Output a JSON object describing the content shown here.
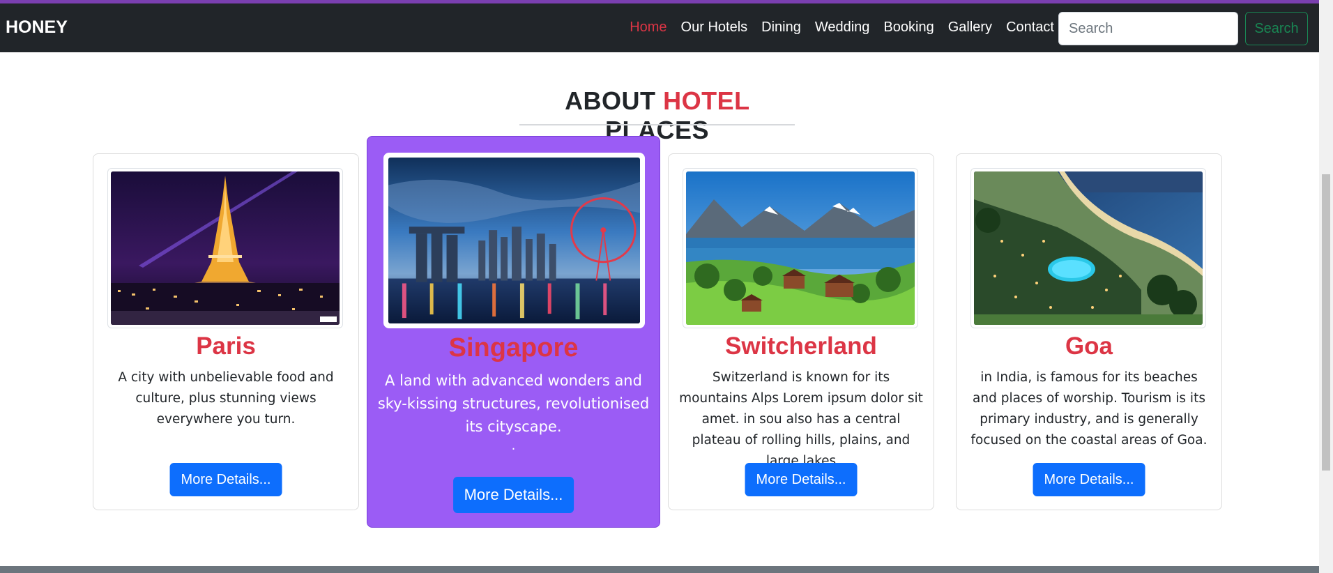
{
  "nav": {
    "brand": "HONEY",
    "links": [
      {
        "label": "Home",
        "active": true
      },
      {
        "label": "Our Hotels"
      },
      {
        "label": "Dining"
      },
      {
        "label": "Wedding"
      },
      {
        "label": "Booking"
      },
      {
        "label": "Gallery"
      },
      {
        "label": "Contact"
      }
    ],
    "search_placeholder": "Search",
    "search_button": "Search"
  },
  "section": {
    "heading_part1": "ABOUT",
    "heading_accent": "HOTEL",
    "heading_part2": "PLACES"
  },
  "cards": [
    {
      "title": "Paris",
      "text": "A city with unbelievable food and culture, plus stunning views everywhere you turn.",
      "button": "More Details..."
    },
    {
      "title": "Singapore",
      "text": "A land with advanced wonders and sky-kissing structures, revolutionised its cityscape.",
      "dot": ".",
      "button": "More Details..."
    },
    {
      "title": "Switcherland",
      "text": "Switzerland is known for its mountains Alps Lorem ipsum dolor sit amet. in sou also has a central plateau of rolling hills, plains, and large lakes",
      "button": "More Details..."
    },
    {
      "title": "Goa",
      "text": "in India, is famous for its beaches and places of worship. Tourism is its primary industry, and is generally focused on the coastal areas of Goa.",
      "button": "More Details..."
    }
  ],
  "colors": {
    "accent_red": "#dc3545",
    "featured_purple": "#9b5cf5",
    "button_blue": "#0d6efd",
    "navbar_dark": "#212529",
    "search_green": "#198754"
  }
}
